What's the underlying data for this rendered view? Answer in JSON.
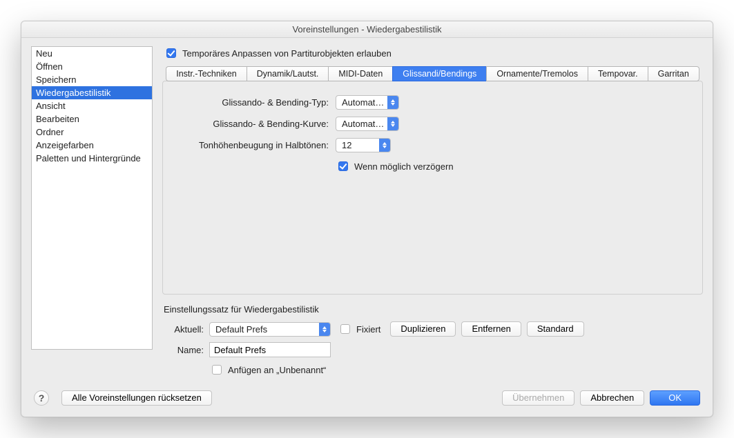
{
  "title": "Voreinstellungen - Wiedergabestilistik",
  "sidebar": {
    "items": [
      {
        "label": "Neu"
      },
      {
        "label": "Öffnen"
      },
      {
        "label": "Speichern"
      },
      {
        "label": "Wiedergabestilistik",
        "selected": true
      },
      {
        "label": "Ansicht"
      },
      {
        "label": "Bearbeiten"
      },
      {
        "label": "Ordner"
      },
      {
        "label": "Anzeigefarben"
      },
      {
        "label": "Paletten und Hintergründe"
      }
    ]
  },
  "allowTempAdjust": {
    "label": "Temporäres Anpassen von Partiturobjekten erlauben",
    "checked": true
  },
  "tabs": [
    {
      "label": "Instr.-Techniken"
    },
    {
      "label": "Dynamik/Lautst."
    },
    {
      "label": "MIDI-Daten"
    },
    {
      "label": "Glissandi/Bendings",
      "active": true
    },
    {
      "label": "Ornamente/Tremolos"
    },
    {
      "label": "Tempovar."
    },
    {
      "label": "Garritan"
    }
  ],
  "gliss": {
    "typeLabel": "Glissando- & Bending-Typ:",
    "typeValue": "Automatis…",
    "curveLabel": "Glissando- & Bending-Kurve:",
    "curveValue": "Automatis…",
    "pitchLabel": "Tonhöhenbeugung in Halbtönen:",
    "pitchValue": "12",
    "delayLabel": "Wenn möglich verzögern",
    "delayChecked": true
  },
  "presetSection": {
    "title": "Einstellungssatz für Wiedergabestilistik",
    "currentLabel": "Aktuell:",
    "currentValue": "Default Prefs",
    "fixedLabel": "Fixiert",
    "fixedChecked": false,
    "dup": "Duplizieren",
    "rem": "Entfernen",
    "def": "Standard",
    "nameLabel": "Name:",
    "nameValue": "Default Prefs",
    "appendLabel": "Anfügen an „Unbenannt“",
    "appendChecked": false
  },
  "footer": {
    "resetAll": "Alle Voreinstellungen rücksetzen",
    "apply": "Übernehmen",
    "cancel": "Abbrechen",
    "ok": "OK"
  }
}
